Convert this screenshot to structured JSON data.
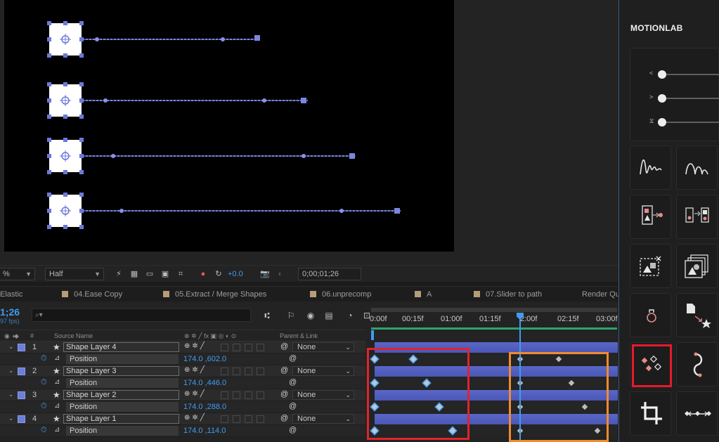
{
  "viewer": {
    "zoom": "%",
    "resolution": "Half",
    "exposure": "+0.0",
    "timecode": "0;00;01;26"
  },
  "tabs": [
    {
      "label": "Elastic"
    },
    {
      "label": "04.Ease Copy"
    },
    {
      "label": "05.Extract / Merge Shapes"
    },
    {
      "label": "06.unprecomp"
    },
    {
      "label": "A"
    },
    {
      "label": "07.Slider to path"
    },
    {
      "label": "Render Qu"
    }
  ],
  "timeline": {
    "current_time": "1;26",
    "fps": "97 fps)",
    "search_placeholder": "",
    "columns": {
      "number": "#",
      "source_name": "Source Name",
      "parent_link": "Parent & Link"
    },
    "ruler_labels": [
      "0:00f",
      "00:15f",
      "01:00f",
      "01:15f",
      "2:00f",
      "02:15f",
      "03:00f"
    ],
    "layers": [
      {
        "index": "1",
        "name": "Shape Layer 4",
        "parent": "None",
        "property": "Position",
        "value": "174.0 ,602.0"
      },
      {
        "index": "2",
        "name": "Shape Layer 3",
        "parent": "None",
        "property": "Position",
        "value": "174.0 ,446.0"
      },
      {
        "index": "3",
        "name": "Shape Layer 2",
        "parent": "None",
        "property": "Position",
        "value": "174.0 ,288.0"
      },
      {
        "index": "4",
        "name": "Shape Layer 1",
        "parent": "None",
        "property": "Position",
        "value": "174.0 ,114.0"
      }
    ]
  },
  "panel": {
    "title": "MOTIONLAB",
    "sliders": [
      {
        "label": "<",
        "value": 0
      },
      {
        "label": ">",
        "value": 0
      },
      {
        "label": "⧖",
        "value": 0
      }
    ],
    "buttons": [
      "wave-elastic-icon",
      "wave-bounce-icon",
      "shape-to-point-icon",
      "point-to-shape-icon",
      "extract-shapes-icon",
      "merge-layers-icon",
      "anchor-drop-icon",
      "file-to-star-icon",
      "keyframe-scatter-icon",
      "path-hook-icon",
      "crop-icon",
      "distribute-icon"
    ],
    "accent": "#e8192c"
  },
  "colors": {
    "accent_blue": "#3f9cf2",
    "layer_label": "#6b7fd9",
    "highlight_red": "#e0242e",
    "highlight_orange": "#f28a30"
  }
}
